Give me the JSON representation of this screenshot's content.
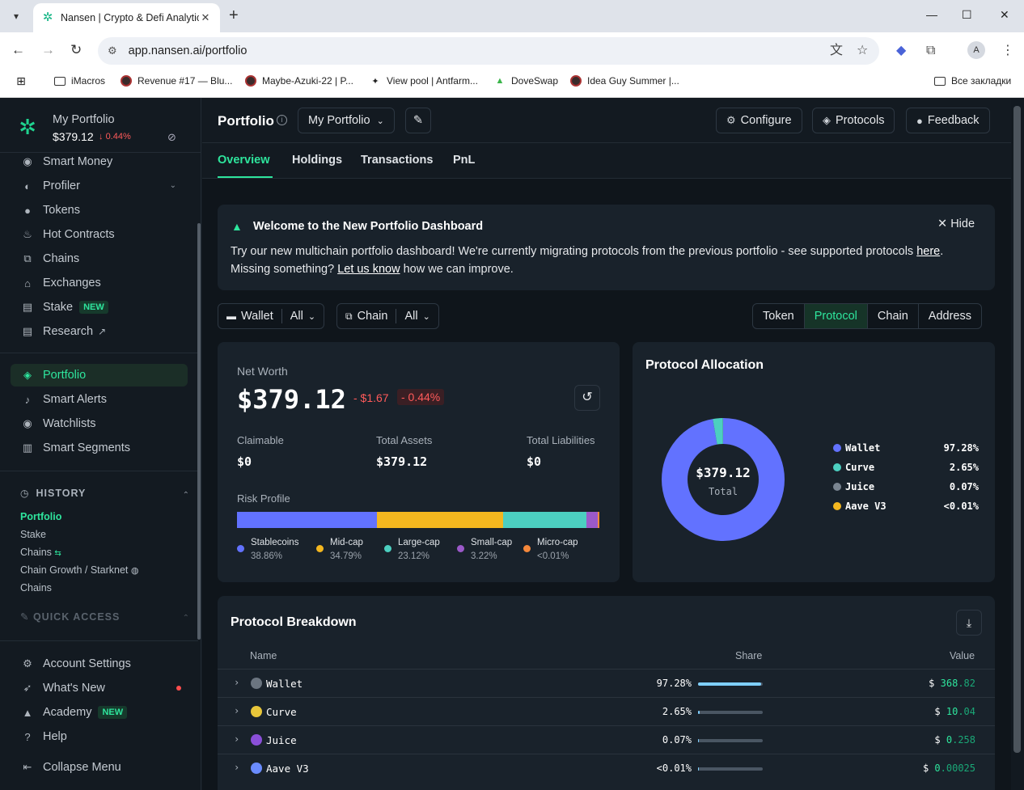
{
  "browser": {
    "tab_title": "Nansen | Crypto & Defi Analytic",
    "url": "app.nansen.ai/portfolio",
    "bookmarks": [
      "iMacros",
      "Revenue #17 — Blu...",
      "Maybe-Azuki-22 | P...",
      "View pool | Antfarm...",
      "DoveSwap",
      "Idea Guy Summer |..."
    ],
    "bookmarks_all": "Все закладки",
    "avatar_letter": "A"
  },
  "sidebar": {
    "portfolio_name": "My Portfolio",
    "portfolio_value": "$379.12",
    "portfolio_change": "0.44%",
    "nav_top": [
      {
        "label": "Smart Money",
        "icon": "smart-money-icon"
      },
      {
        "label": "Profiler",
        "icon": "profiler-icon"
      },
      {
        "label": "Tokens",
        "icon": "tokens-icon"
      },
      {
        "label": "Hot Contracts",
        "icon": "flame-icon"
      },
      {
        "label": "Chains",
        "icon": "chains-icon"
      },
      {
        "label": "Exchanges",
        "icon": "bank-icon"
      },
      {
        "label": "Stake",
        "icon": "stake-icon",
        "badge": "NEW"
      },
      {
        "label": "Research",
        "icon": "document-icon"
      }
    ],
    "nav_mid": [
      {
        "label": "Portfolio",
        "icon": "layers-icon"
      },
      {
        "label": "Smart Alerts",
        "icon": "bell-icon"
      },
      {
        "label": "Watchlists",
        "icon": "eye-icon"
      },
      {
        "label": "Smart Segments",
        "icon": "segments-icon"
      }
    ],
    "history_title": "HISTORY",
    "history_links": [
      "Portfolio",
      "Stake",
      "Chains",
      "Chain Growth / Starknet",
      "Chains"
    ],
    "quick_access_title": "QUICK ACCESS",
    "nav_bottom": [
      {
        "label": "Account Settings",
        "icon": "gear-icon"
      },
      {
        "label": "What's New",
        "icon": "rocket-icon"
      },
      {
        "label": "Academy",
        "icon": "academy-icon",
        "badge": "NEW"
      },
      {
        "label": "Help",
        "icon": "help-icon"
      },
      {
        "label": "Collapse Menu",
        "icon": "collapse-icon"
      }
    ]
  },
  "header": {
    "title": "Portfolio",
    "portfolio_select": "My Portfolio",
    "configure": "Configure",
    "protocols": "Protocols",
    "feedback": "Feedback"
  },
  "tabs": [
    "Overview",
    "Holdings",
    "Transactions",
    "PnL"
  ],
  "banner": {
    "title": "Welcome to the New Portfolio Dashboard",
    "hide": "Hide",
    "text_1": "Try our new multichain portfolio dashboard! We're currently migrating protocols from the previous portfolio - see supported protocols",
    "link_here": "here",
    "text_2": ". Missing something?",
    "link_let": "Let us know",
    "text_3": "how we can improve."
  },
  "filters": {
    "wallet_label": "Wallet",
    "wallet_value": "All",
    "chain_label": "Chain",
    "chain_value": "All",
    "group_options": [
      "Token",
      "Protocol",
      "Chain",
      "Address"
    ],
    "group_selected": "Protocol"
  },
  "networth": {
    "label": "Net Worth",
    "value": "$379.12",
    "change_abs": "- $1.67",
    "change_pct": "- 0.44%",
    "claimable_label": "Claimable",
    "claimable": "$0",
    "assets_label": "Total Assets",
    "assets": "$379.12",
    "liab_label": "Total Liabilities",
    "liab": "$0",
    "risk_label": "Risk Profile",
    "risk": [
      {
        "name": "Stablecoins",
        "pct": "38.86%",
        "value": 38.86,
        "color": "#6272ff"
      },
      {
        "name": "Mid-cap",
        "pct": "34.79%",
        "value": 34.79,
        "color": "#f4b71f"
      },
      {
        "name": "Large-cap",
        "pct": "23.12%",
        "value": 23.12,
        "color": "#4ccfc0"
      },
      {
        "name": "Small-cap",
        "pct": "3.22%",
        "value": 3.22,
        "color": "#9b59c9"
      },
      {
        "name": "Micro-cap",
        "pct": "<0.01%",
        "value": 0.01,
        "color": "#f5883b"
      }
    ]
  },
  "allocation": {
    "title": "Protocol Allocation",
    "center_value": "$379.12",
    "center_label": "Total",
    "items": [
      {
        "name": "Wallet",
        "pct": "97.28%",
        "value": 97.28,
        "color": "#6272ff"
      },
      {
        "name": "Curve",
        "pct": "2.65%",
        "value": 2.65,
        "color": "#4ccfc0"
      },
      {
        "name": "Juice",
        "pct": "0.07%",
        "value": 0.07,
        "color": "#7a8591"
      },
      {
        "name": "Aave V3",
        "pct": "<0.01%",
        "value": 0.01,
        "color": "#f4b71f"
      }
    ]
  },
  "breakdown": {
    "title": "Protocol Breakdown",
    "col_name": "Name",
    "col_share": "Share",
    "col_value": "Value",
    "rows": [
      {
        "name": "Wallet",
        "share": "97.28%",
        "share_val": 97.28,
        "int": "368",
        "dec": ".82",
        "icon_color": "#6b7580"
      },
      {
        "name": "Curve",
        "share": "2.65%",
        "share_val": 2.65,
        "int": "10",
        "dec": ".04",
        "icon_color": "#e8c63a"
      },
      {
        "name": "Juice",
        "share": "0.07%",
        "share_val": 0.07,
        "int": "0",
        "dec": ".258",
        "icon_color": "#8a4fd8"
      },
      {
        "name": "Aave V3",
        "share": "<0.01%",
        "share_val": 0.01,
        "int": "0",
        "dec": ".00025",
        "icon_color": "#6a8cff"
      }
    ]
  }
}
